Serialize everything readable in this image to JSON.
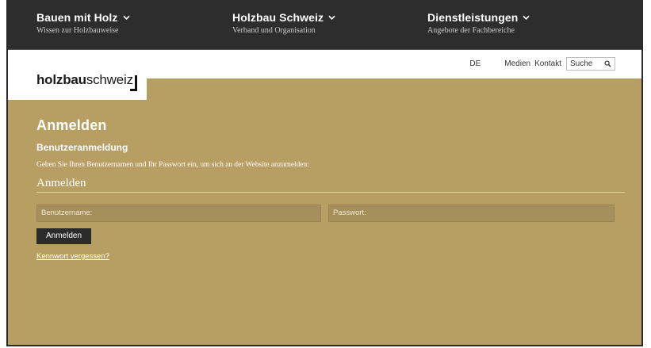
{
  "nav": [
    {
      "title": "Bauen mit Holz",
      "subtitle": "Wissen zur Holzbauweise"
    },
    {
      "title": "Holzbau Schweiz",
      "subtitle": "Verband und Organisation"
    },
    {
      "title": "Dienstleistungen",
      "subtitle": "Angebote der Fachbereiche"
    }
  ],
  "logo": {
    "bold": "holzbau",
    "regular": "schweiz"
  },
  "utility": {
    "language": "DE",
    "links": [
      "Medien",
      "Kontakt"
    ],
    "search_placeholder": "Suche"
  },
  "page": {
    "title": "Anmelden",
    "subtitle": "Benutzeranmeldung",
    "description": "Geben Sie Ihren Benutzernamen und Ihr Passwort ein, um sich an der Website anzumelden:",
    "section_title": "Anmelden",
    "username_placeholder": "Benutzername:",
    "password_placeholder": "Passwort:",
    "submit_label": "Anmelden",
    "forgot_link": "Kennwort vergessen?"
  },
  "colors": {
    "nav_background": "#2d2d2d",
    "content_background": "#b79e63",
    "input_background": "#a58f5a",
    "button_background": "#2b2b2b"
  }
}
